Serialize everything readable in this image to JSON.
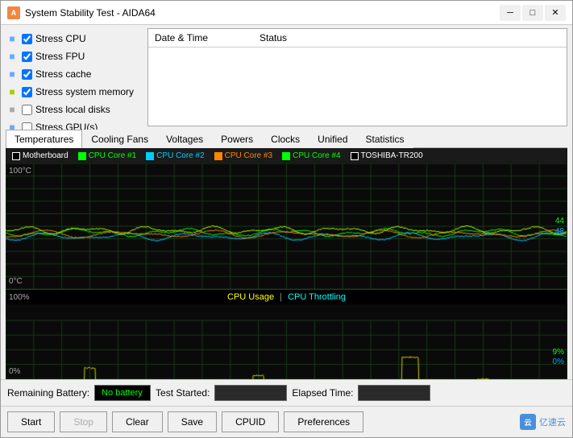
{
  "window": {
    "title": "System Stability Test - AIDA64",
    "controls": {
      "minimize": "─",
      "maximize": "□",
      "close": "✕"
    }
  },
  "checkboxes": [
    {
      "id": "stress-cpu",
      "label": "Stress CPU",
      "checked": true,
      "icon": "cpu"
    },
    {
      "id": "stress-fpu",
      "label": "Stress FPU",
      "checked": true,
      "icon": "fpu"
    },
    {
      "id": "stress-cache",
      "label": "Stress cache",
      "checked": true,
      "icon": "cache"
    },
    {
      "id": "stress-memory",
      "label": "Stress system memory",
      "checked": true,
      "icon": "memory"
    },
    {
      "id": "stress-disks",
      "label": "Stress local disks",
      "checked": false,
      "icon": "disk"
    },
    {
      "id": "stress-gpu",
      "label": "Stress GPU(s)",
      "checked": false,
      "icon": "gpu"
    }
  ],
  "table": {
    "col1": "Date & Time",
    "col2": "Status"
  },
  "tabs": [
    {
      "id": "temperatures",
      "label": "Temperatures",
      "active": true
    },
    {
      "id": "cooling-fans",
      "label": "Cooling Fans",
      "active": false
    },
    {
      "id": "voltages",
      "label": "Voltages",
      "active": false
    },
    {
      "id": "powers",
      "label": "Powers",
      "active": false
    },
    {
      "id": "clocks",
      "label": "Clocks",
      "active": false
    },
    {
      "id": "unified",
      "label": "Unified",
      "active": false
    },
    {
      "id": "statistics",
      "label": "Statistics",
      "active": false
    }
  ],
  "chart": {
    "legend": [
      {
        "label": "Motherboard",
        "color": "#fff",
        "checked": false
      },
      {
        "label": "CPU Core #1",
        "color": "#00ff00",
        "checked": true
      },
      {
        "label": "CPU Core #2",
        "color": "#00ccff",
        "checked": true
      },
      {
        "label": "CPU Core #3",
        "color": "#ff8800",
        "checked": true
      },
      {
        "label": "CPU Core #4",
        "color": "#00ff00",
        "checked": true
      },
      {
        "label": "TOSHIBA-TR200",
        "color": "#fff",
        "checked": false
      }
    ],
    "temp_max_label": "100°C",
    "temp_min_label": "0°C",
    "temp_value": "44",
    "usage_max_label": "100%",
    "usage_min_label": "0%",
    "usage_legend": [
      {
        "label": "CPU Usage",
        "color": "#ffff00"
      },
      {
        "label": "|",
        "color": "#888"
      },
      {
        "label": "CPU Throttling",
        "color": "#00ffff"
      }
    ],
    "usage_value_right": "9%",
    "usage_value_right2": "0%"
  },
  "status_bar": {
    "battery_label": "Remaining Battery:",
    "battery_value": "No battery",
    "started_label": "Test Started:",
    "started_value": "",
    "elapsed_label": "Elapsed Time:",
    "elapsed_value": ""
  },
  "actions": {
    "start": "Start",
    "stop": "Stop",
    "clear": "Clear",
    "save": "Save",
    "cpuid": "CPUID",
    "preferences": "Preferences"
  },
  "watermark": "亿速云"
}
